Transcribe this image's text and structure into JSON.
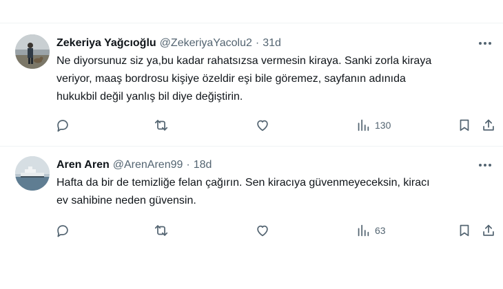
{
  "tweets": [
    {
      "name": "Zekeriya Yağcıoğlu",
      "handle": "@ZekeriyaYacolu2",
      "separator": "·",
      "time": "31d",
      "text": "Ne diyorsunuz siz ya,bu kadar rahatsızsa vermesin kiraya. Sanki zorla kiraya\nveriyor, maaş bordrosu kişiye özeldir eşi bile göremez, sayfanın adınıda\nhukukbil değil yanlış bil diye değiştirin.",
      "views": "130",
      "avatar_icon": "person-with-dog-photo"
    },
    {
      "name": "Aren Aren",
      "handle": "@ArenAren99",
      "separator": "·",
      "time": "18d",
      "text": "Hafta da bir de temizliğe felan çağırın. Sen kiracıya güvenmeyeceksin, kiracı\nev sahibine neden güvensin.",
      "views": "63",
      "avatar_icon": "ship-on-sea-photo"
    }
  ],
  "icons": {
    "more": "more-horizontal-icon",
    "reply": "reply-icon",
    "retweet": "retweet-icon",
    "like": "heart-icon",
    "views": "analytics-icon",
    "bookmark": "bookmark-icon",
    "share": "share-icon"
  },
  "colors": {
    "text_primary": "#0f1419",
    "text_secondary": "#536471",
    "divider": "#eff3f4",
    "background": "#ffffff"
  }
}
